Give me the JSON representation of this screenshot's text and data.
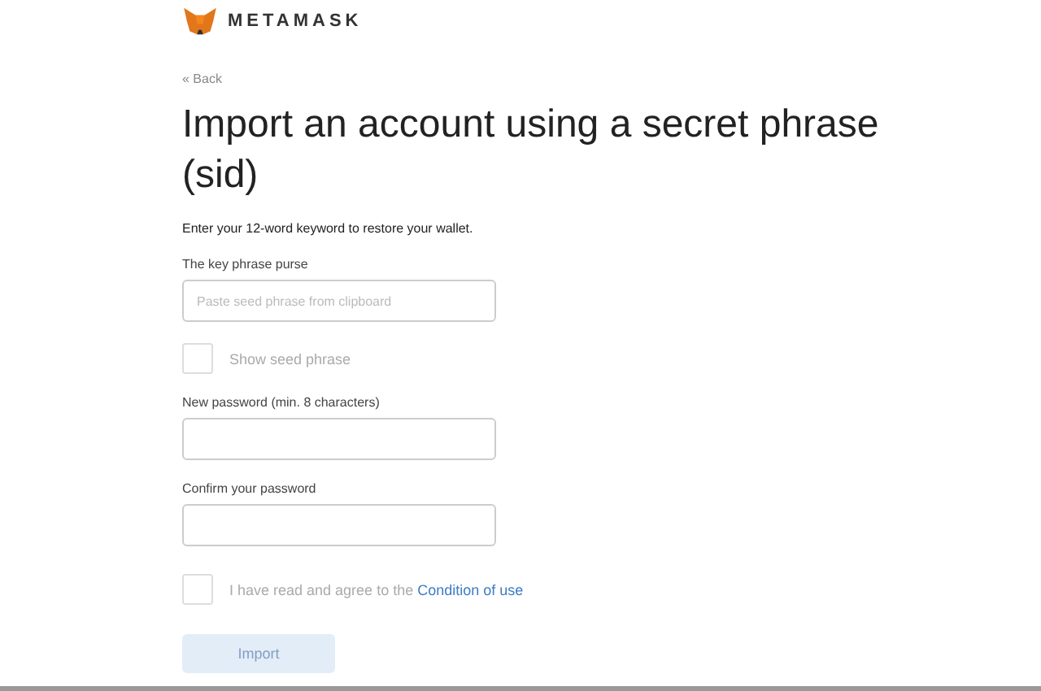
{
  "brand": {
    "name": "METAMASK"
  },
  "back_link": "« Back",
  "title": "Import an account using a secret phrase (sid)",
  "description": "Enter your 12-word keyword to restore your wallet.",
  "fields": [
    {
      "kind": "text",
      "label": "The key phrase purse",
      "placeholder": "Paste seed phrase from clipboard"
    },
    {
      "kind": "checkbox",
      "label": "Show seed phrase",
      "checked": false
    },
    {
      "kind": "text",
      "label": "New password (min. 8 characters)"
    },
    {
      "kind": "text",
      "label": "Confirm your password"
    }
  ],
  "terms": {
    "checked": false,
    "text": "I have read and agree to the",
    "link": "Condition of use"
  },
  "submit": {
    "label": "Import",
    "disabled": true
  }
}
